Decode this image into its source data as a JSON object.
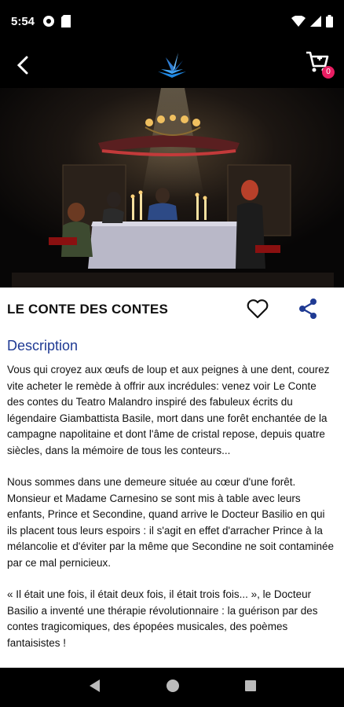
{
  "status_bar": {
    "time": "5:54"
  },
  "app_bar": {
    "cart_count": "0"
  },
  "show": {
    "title": "LE CONTE DES CONTES",
    "description_heading": "Description",
    "paragraphs": [
      "Vous qui croyez aux œufs de loup et aux peignes à une dent, courez vite acheter le remède à offrir aux incrédules: venez voir Le Conte des contes du Teatro Malandro inspiré des fabuleux écrits du légendaire Giambattista Basile, mort dans une forêt enchantée de la campagne napolitaine et dont l'âme de cristal repose, depuis quatre siècles, dans la mémoire de tous les conteurs...",
      "Nous sommes dans une demeure située au cœur d'une forêt. Monsieur et Madame Carnesino se sont mis à table avec leurs enfants, Prince et Secondine, quand arrive le Docteur Basilio en qui ils placent tous leurs espoirs : il s'agit en effet d'arracher Prince à la mélancolie et d'éviter par la même que Secondine ne soit contaminée par ce mal pernicieux.",
      "« Il était une fois, il était deux fois, il était trois fois... », le Docteur Basilio a inventé une thérapie révolutionnaire : la guérison par des contes tragicomiques, des épopées musicales, des poèmes fantaisistes !"
    ]
  },
  "colors": {
    "accent": "#1f3a93",
    "badge": "#e91e63",
    "logo": "#2f7fd6"
  },
  "icons": [
    "back-icon",
    "logo-icon",
    "cart-icon",
    "heart-icon",
    "share-icon",
    "nav-back-icon",
    "nav-home-icon",
    "nav-recents-icon"
  ]
}
